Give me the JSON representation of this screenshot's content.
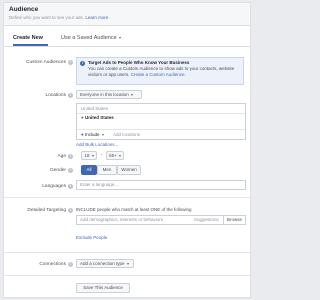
{
  "header": {
    "title": "Audience",
    "subtitle": "Define who you want to see your ads.",
    "learn_more": "Learn more"
  },
  "tabs": {
    "create_new": "Create New",
    "saved": "Use a Saved Audience"
  },
  "custom_audiences": {
    "label": "Custom Audiences",
    "callout_title": "Target Ads to People Who Know Your Business",
    "callout_body": "You can create a Custom Audience to show ads to your contacts, website visitors or app users.",
    "callout_link": "Create a Custom Audience."
  },
  "locations": {
    "label": "Locations",
    "selector": "Everyone in this location",
    "country_header": "United States",
    "selected": "United States",
    "include": "Include",
    "add_placeholder": "Add locations",
    "bulk": "Add Bulk Locations..."
  },
  "age": {
    "label": "Age",
    "min": "18",
    "dash": "-",
    "max": "65+"
  },
  "gender": {
    "label": "Gender",
    "options": [
      "All",
      "Men",
      "Women"
    ]
  },
  "languages": {
    "label": "Languages",
    "placeholder": "Enter a language..."
  },
  "detailed": {
    "label": "Detailed Targeting",
    "include_text": "INCLUDE people who match at least ONE of the following",
    "placeholder": "Add demographics, interests or behaviors",
    "suggestions": "Suggestions",
    "browse": "Browse",
    "exclude": "Exclude People"
  },
  "connections": {
    "label": "Connections",
    "selector": "Add a connection type"
  },
  "save_button": "Save This Audience"
}
